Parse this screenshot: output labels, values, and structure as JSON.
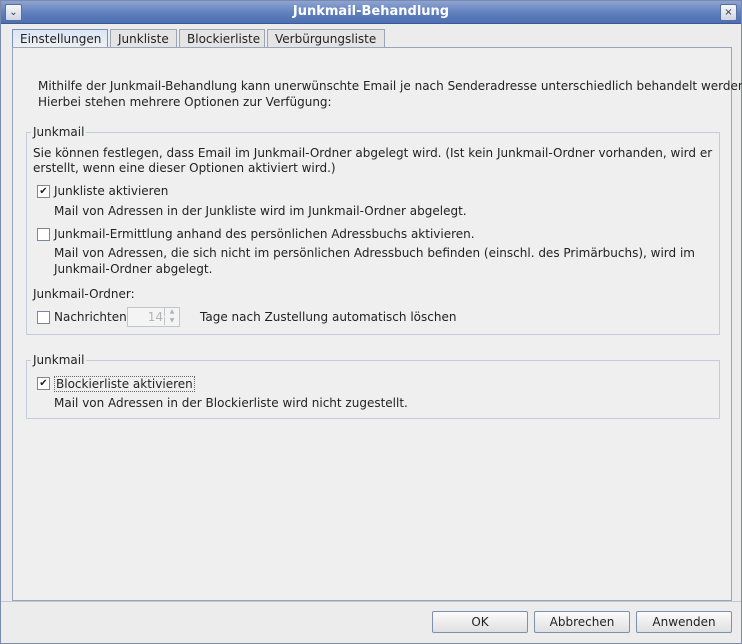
{
  "window": {
    "title": "Junkmail-Behandlung"
  },
  "tabs": [
    {
      "label": "Einstellungen",
      "active": true
    },
    {
      "label": "Junkliste",
      "active": false
    },
    {
      "label": "Blockierliste",
      "active": false
    },
    {
      "label": "Verbürgungsliste",
      "active": false
    }
  ],
  "intro": {
    "line1": "Mithilfe der Junkmail-Behandlung kann unerwünschte Email je nach Senderadresse unterschiedlich behandelt werden.",
    "line2": "Hierbei stehen mehrere Optionen zur Verfügung:"
  },
  "group1": {
    "label": "Junkmail",
    "desc_line1": "Sie können festlegen, dass Email im Junkmail-Ordner abgelegt wird. (Ist kein Junkmail-Ordner vorhanden, wird er",
    "desc_line2": "erstellt, wenn eine dieser Optionen aktiviert wird.)",
    "junkliste": {
      "label": "Junkliste aktivieren",
      "checked": true,
      "desc": "Mail von Adressen in der Junkliste wird im Junkmail-Ordner abgelegt."
    },
    "adressbuch": {
      "label": "Junkmail-Ermittlung anhand des persönlichen Adressbuchs aktivieren.",
      "checked": false,
      "desc_line1": "Mail von Adressen, die sich nicht im persönlichen Adressbuch befinden (einschl. des Primärbuchs), wird im",
      "desc_line2": "Junkmail-Ordner abgelegt."
    },
    "ordner_label": "Junkmail-Ordner:",
    "nachrichten": {
      "label": "Nachrichten",
      "checked": false,
      "days": "14",
      "suffix": "Tage nach Zustellung automatisch löschen"
    }
  },
  "group2": {
    "label": "Junkmail",
    "blockierliste": {
      "label": "Blockierliste aktivieren",
      "checked": true,
      "desc": "Mail von Adressen in der Blockierliste wird nicht zugestellt."
    }
  },
  "buttons": {
    "ok": "OK",
    "cancel": "Abbrechen",
    "apply": "Anwenden"
  }
}
